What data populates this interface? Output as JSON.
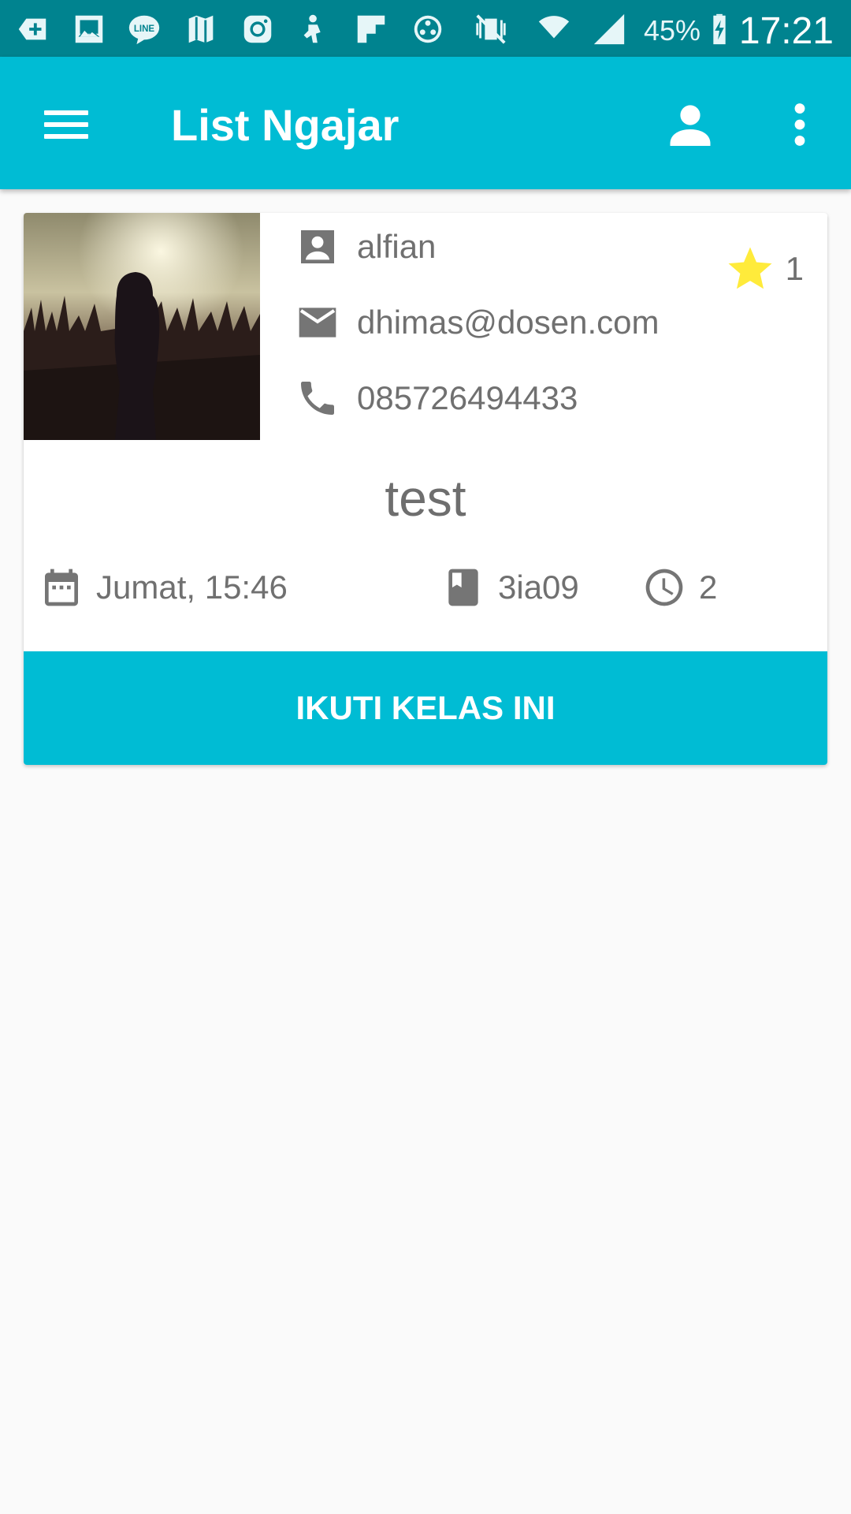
{
  "status_bar": {
    "battery_percent": "45%",
    "time": "17:21"
  },
  "app_bar": {
    "title": "List Ngajar",
    "menu_icon": "menu-icon",
    "profile_icon": "account-icon",
    "overflow_icon": "more-vert-icon"
  },
  "cards": [
    {
      "teacher_name": "alfian",
      "email": "dhimas@dosen.com",
      "phone": "085726494433",
      "rating": "1",
      "title": "test",
      "schedule": "Jumat, 15:46",
      "class_code": "3ia09",
      "duration": "2",
      "join_label": "IKUTI KELAS INI"
    }
  ],
  "colors": {
    "primary": "#00bcd4",
    "primary_dark": "#00838f",
    "star": "#ffeb3b",
    "secondary_text": "#707070"
  }
}
